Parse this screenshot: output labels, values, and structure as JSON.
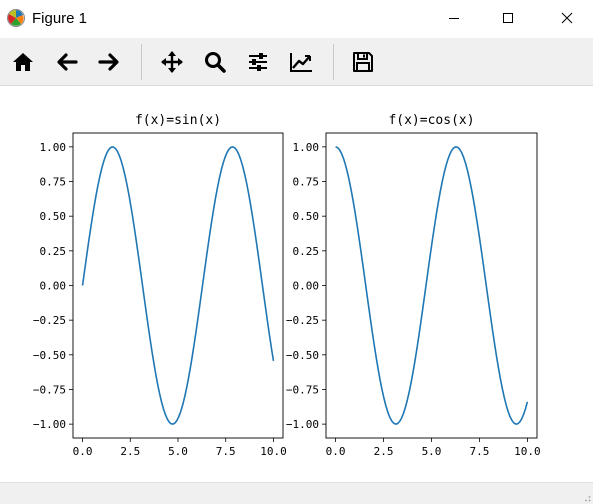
{
  "window": {
    "title": "Figure 1",
    "icons": [
      "matplotlib-logo-icon",
      "minimize-icon",
      "maximize-icon",
      "close-icon"
    ]
  },
  "toolbar": {
    "buttons": [
      {
        "name": "home",
        "icon": "home-icon"
      },
      {
        "name": "back",
        "icon": "arrow-left-icon"
      },
      {
        "name": "forward",
        "icon": "arrow-right-icon"
      },
      {
        "name": "pan",
        "icon": "move-icon"
      },
      {
        "name": "zoom",
        "icon": "magnifier-icon"
      },
      {
        "name": "configure-subplots",
        "icon": "sliders-icon"
      },
      {
        "name": "edit-axis",
        "icon": "chart-edit-icon"
      },
      {
        "name": "save",
        "icon": "floppy-disk-icon"
      }
    ]
  },
  "colors": {
    "line": "#1f77b4",
    "toolbar_bg": "#f0f0f0"
  },
  "chart_data": [
    {
      "type": "line",
      "title": "f(x)=sin(x)",
      "function": "sin",
      "x_range": [
        0,
        10
      ],
      "samples": 100,
      "xlim": [
        -0.5,
        10.5
      ],
      "ylim": [
        -1.1,
        1.1
      ],
      "xticks": [
        "0.0",
        "2.5",
        "5.0",
        "7.5",
        "10.0"
      ],
      "yticks": [
        "1.00",
        "0.75",
        "0.50",
        "0.25",
        "0.00",
        "−0.25",
        "−0.50",
        "−0.75",
        "−1.00"
      ],
      "grid": false,
      "x": [
        0,
        0.5,
        1,
        1.5,
        2,
        2.5,
        3,
        3.5,
        4,
        4.5,
        5,
        5.5,
        6,
        6.5,
        7,
        7.5,
        8,
        8.5,
        9,
        9.5,
        10
      ],
      "y": [
        0.0,
        0.479,
        0.841,
        0.997,
        0.909,
        0.598,
        0.141,
        -0.351,
        -0.757,
        -0.978,
        -0.959,
        -0.706,
        -0.279,
        0.215,
        0.657,
        0.938,
        0.989,
        0.798,
        0.412,
        -0.075,
        -0.544
      ]
    },
    {
      "type": "line",
      "title": "f(x)=cos(x)",
      "function": "cos",
      "x_range": [
        0,
        10
      ],
      "samples": 100,
      "xlim": [
        -0.5,
        10.5
      ],
      "ylim": [
        -1.1,
        1.1
      ],
      "xticks": [
        "0.0",
        "2.5",
        "5.0",
        "7.5",
        "10.0"
      ],
      "yticks": [
        "1.00",
        "0.75",
        "0.50",
        "0.25",
        "0.00",
        "−0.25",
        "−0.50",
        "−0.75",
        "−1.00"
      ],
      "grid": false,
      "x": [
        0,
        0.5,
        1,
        1.5,
        2,
        2.5,
        3,
        3.5,
        4,
        4.5,
        5,
        5.5,
        6,
        6.5,
        7,
        7.5,
        8,
        8.5,
        9,
        9.5,
        10
      ],
      "y": [
        1.0,
        0.878,
        0.54,
        0.071,
        -0.416,
        -0.801,
        -0.99,
        -0.936,
        -0.654,
        -0.211,
        0.284,
        0.709,
        0.96,
        0.977,
        0.754,
        0.347,
        -0.146,
        -0.602,
        -0.911,
        -0.997,
        -0.839
      ]
    }
  ]
}
